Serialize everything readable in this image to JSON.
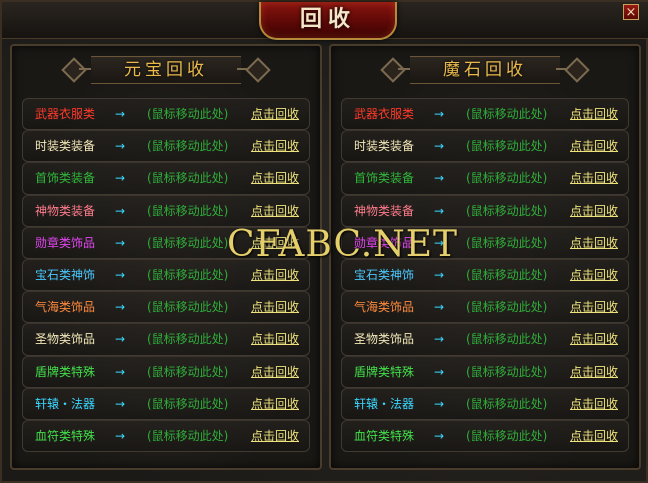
{
  "window": {
    "title": "回收",
    "close_glyph": "×"
  },
  "arrow_glyph": "→",
  "colors": {
    "gold": "#e9b94b",
    "link": "#ede27c",
    "hint": "#2fae3a",
    "arrow": "#3ad7ff"
  },
  "panels": [
    {
      "title": "元宝回收",
      "rows": [
        {
          "category": "武器衣服类",
          "color": "#ff3a2a",
          "hint": "(鼠标移动此处)",
          "action": "点击回收"
        },
        {
          "category": "时装类装备",
          "color": "#f2e8b8",
          "hint": "(鼠标移动此处)",
          "action": "点击回收"
        },
        {
          "category": "首饰类装备",
          "color": "#2fb83a",
          "hint": "(鼠标移动此处)",
          "action": "点击回收"
        },
        {
          "category": "神物类装备",
          "color": "#ff7c8c",
          "hint": "(鼠标移动此处)",
          "action": "点击回收"
        },
        {
          "category": "勋章类饰品",
          "color": "#e245f0",
          "hint": "(鼠标移动此处)",
          "action": "点击回收"
        },
        {
          "category": "宝石类神饰",
          "color": "#4ac8ff",
          "hint": "(鼠标移动此处)",
          "action": "点击回收"
        },
        {
          "category": "气海类饰品",
          "color": "#ff8a3c",
          "hint": "(鼠标移动此处)",
          "action": "点击回收"
        },
        {
          "category": "圣物类饰品",
          "color": "#f2e8b8",
          "hint": "(鼠标移动此处)",
          "action": "点击回收"
        },
        {
          "category": "盾牌类特殊",
          "color": "#42e04a",
          "hint": "(鼠标移动此处)",
          "action": "点击回收"
        },
        {
          "category": "轩辕・法器",
          "color": "#3ad7ff",
          "hint": "(鼠标移动此处)",
          "action": "点击回收"
        },
        {
          "category": "血符类特殊",
          "color": "#42e04a",
          "hint": "(鼠标移动此处)",
          "action": "点击回收"
        }
      ]
    },
    {
      "title": "魔石回收",
      "rows": [
        {
          "category": "武器衣服类",
          "color": "#ff3a2a",
          "hint": "(鼠标移动此处)",
          "action": "点击回收"
        },
        {
          "category": "时装类装备",
          "color": "#f2e8b8",
          "hint": "(鼠标移动此处)",
          "action": "点击回收"
        },
        {
          "category": "首饰类装备",
          "color": "#2fb83a",
          "hint": "(鼠标移动此处)",
          "action": "点击回收"
        },
        {
          "category": "神物类装备",
          "color": "#ff7c8c",
          "hint": "(鼠标移动此处)",
          "action": "点击回收"
        },
        {
          "category": "勋章类饰品",
          "color": "#e245f0",
          "hint": "(鼠标移动此处)",
          "action": "点击回收"
        },
        {
          "category": "宝石类神饰",
          "color": "#4ac8ff",
          "hint": "(鼠标移动此处)",
          "action": "点击回收"
        },
        {
          "category": "气海类饰品",
          "color": "#ff8a3c",
          "hint": "(鼠标移动此处)",
          "action": "点击回收"
        },
        {
          "category": "圣物类饰品",
          "color": "#f2e8b8",
          "hint": "(鼠标移动此处)",
          "action": "点击回收"
        },
        {
          "category": "盾牌类特殊",
          "color": "#42e04a",
          "hint": "(鼠标移动此处)",
          "action": "点击回收"
        },
        {
          "category": "轩辕・法器",
          "color": "#3ad7ff",
          "hint": "(鼠标移动此处)",
          "action": "点击回收"
        },
        {
          "category": "血符类特殊",
          "color": "#42e04a",
          "hint": "(鼠标移动此处)",
          "action": "点击回收"
        }
      ]
    }
  ],
  "watermark": "CFABC.NET"
}
